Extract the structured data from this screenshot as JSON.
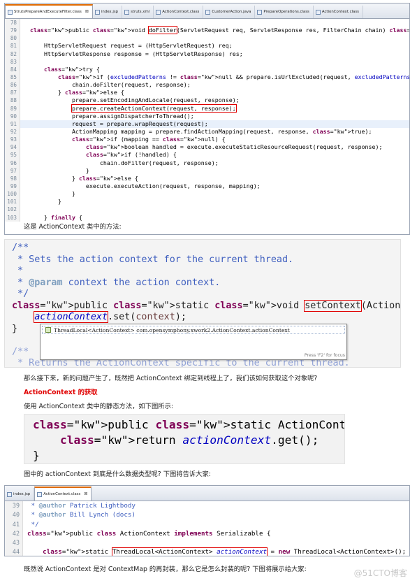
{
  "editor1": {
    "tabs": [
      {
        "label": "StrutsPrepareAndExecuteFilter.class",
        "active": true,
        "icon": "class-file-icon"
      },
      {
        "label": "index.jsp",
        "active": false,
        "icon": "jsp-file-icon"
      },
      {
        "label": "struts.xml",
        "active": false,
        "icon": "xml-file-icon"
      },
      {
        "label": "ActionContext.class",
        "active": false,
        "icon": "class-file-icon"
      },
      {
        "label": "CustomerAction.java",
        "active": false,
        "icon": "java-file-icon"
      },
      {
        "label": "PrepareOperations.class",
        "active": false,
        "icon": "class-file-icon"
      },
      {
        "label": "ActionContext.class",
        "active": false,
        "icon": "class-file-icon"
      }
    ],
    "close_glyph": "⊠",
    "lines": [
      {
        "n": "78",
        "t": ""
      },
      {
        "n": "79",
        "t": "public void doFilter(ServletRequest req, ServletResponse res, FilterChain chain) throws IOException, S",
        "ind": 1
      },
      {
        "n": "80",
        "t": ""
      },
      {
        "n": "81",
        "t": "HttpServletRequest request = (HttpServletRequest) req;",
        "ind": 2
      },
      {
        "n": "82",
        "t": "HttpServletResponse response = (HttpServletResponse) res;",
        "ind": 2
      },
      {
        "n": "83",
        "t": ""
      },
      {
        "n": "84",
        "t": "try {",
        "ind": 2
      },
      {
        "n": "85",
        "t": "if (excludedPatterns != null && prepare.isUrlExcluded(request, excludedPatterns)) {",
        "ind": 3
      },
      {
        "n": "86",
        "t": "chain.doFilter(request, response);",
        "ind": 4
      },
      {
        "n": "87",
        "t": "} else {",
        "ind": 3
      },
      {
        "n": "88",
        "t": "prepare.setEncodingAndLocale(request, response);",
        "ind": 4
      },
      {
        "n": "89",
        "t": "prepare.createActionContext(request, response);",
        "ind": 4
      },
      {
        "n": "90",
        "t": "prepare.assignDispatcherToThread();",
        "ind": 4
      },
      {
        "n": "91",
        "t": "request = prepare.wrapRequest(request);",
        "ind": 4
      },
      {
        "n": "92",
        "t": "ActionMapping mapping = prepare.findActionMapping(request, response, true);",
        "ind": 4
      },
      {
        "n": "93",
        "t": "if (mapping == null) {",
        "ind": 4
      },
      {
        "n": "94",
        "t": "boolean handled = execute.executeStaticResourceRequest(request, response);",
        "ind": 5
      },
      {
        "n": "95",
        "t": "if (!handled) {",
        "ind": 5
      },
      {
        "n": "96",
        "t": "chain.doFilter(request, response);",
        "ind": 6
      },
      {
        "n": "97",
        "t": "}",
        "ind": 5
      },
      {
        "n": "98",
        "t": "} else {",
        "ind": 4
      },
      {
        "n": "99",
        "t": "execute.executeAction(request, response, mapping);",
        "ind": 5
      },
      {
        "n": "100",
        "t": "}",
        "ind": 4
      },
      {
        "n": "101",
        "t": "}",
        "ind": 3
      },
      {
        "n": "102",
        "t": ""
      },
      {
        "n": "103",
        "t": "} finally {",
        "ind": 2
      }
    ]
  },
  "text1": "这是 ActionContext 类中的方法:",
  "panel2": {
    "lines": [
      "/**",
      " * Sets the action context for the current thread.",
      " *",
      " * @param context the action context.",
      " */",
      "public static void setContext(ActionContext context) {",
      "    actionContext.set(context);",
      "}",
      "",
      "/**",
      " * Returns the ActionContext specific to the current thread."
    ],
    "autocomplete_item": "ThreadLocal<ActionContext> com.opensymphony.xwork2.ActionContext.actionContext",
    "autocomplete_hint": "Press 'F2' for focus"
  },
  "text2": "那么接下来，新的问题产生了，既然把 ActionContext 绑定到线程上了，我们该如何获取这个对象呢?",
  "heading": "ActionContext 的获取",
  "text3": "使用 ActionContext 类中的静态方法，如下图所示:",
  "panel3": {
    "lines": [
      "public static ActionContext getContext() {",
      "    return actionContext.get();",
      "}"
    ]
  },
  "text4": "图中的 actionContext 到底是什么数据类型呢? 下图将告诉大家:",
  "editor2": {
    "tabs": [
      {
        "label": "index.jsp",
        "active": false,
        "icon": "jsp-file-icon"
      },
      {
        "label": "ActionContext.class",
        "active": true,
        "icon": "class-file-icon"
      }
    ],
    "lines": [
      {
        "n": "39",
        "t": " * @author Patrick Lightbody"
      },
      {
        "n": "40",
        "t": " * @author Bill Lynch (docs)"
      },
      {
        "n": "41",
        "t": " */"
      },
      {
        "n": "42",
        "t": "public class ActionContext implements Serializable {"
      },
      {
        "n": "43",
        "t": ""
      },
      {
        "n": "44",
        "t": "    static ThreadLocal<ActionContext> actionContext = new ThreadLocal<ActionContext>();"
      },
      {
        "n": "45",
        "t": ""
      }
    ]
  },
  "text5": "既然说 ActionContext 是对 ContextMap 的再封装，那么它是怎么封装的呢? 下图将展示给大家:",
  "watermark": "@51CTO博客"
}
